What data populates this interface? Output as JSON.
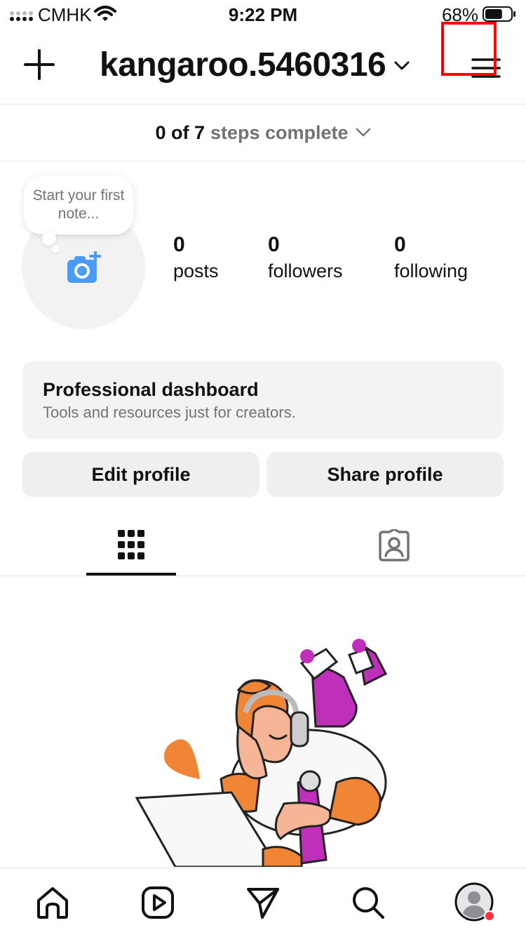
{
  "status_bar": {
    "carrier": "CMHK",
    "time": "9:22 PM",
    "battery_percent": "68%",
    "battery_level": 0.68,
    "icons": [
      "signal-icon",
      "wifi-icon",
      "battery-icon"
    ]
  },
  "header": {
    "username": "kangaroo.5460316",
    "icons": [
      "plus-icon",
      "chevron-down-icon",
      "menu-icon"
    ],
    "highlight_color": "#ff0000"
  },
  "steps": {
    "prefix": "0 of 7",
    "suffix": "steps complete"
  },
  "profile": {
    "note_placeholder": "Start your first note...",
    "camera_icon": "add-photo-icon",
    "accent": "#4a9bf5",
    "stats": [
      {
        "value": "0",
        "label": "posts"
      },
      {
        "value": "0",
        "label": "followers"
      },
      {
        "value": "0",
        "label": "following"
      }
    ]
  },
  "dashboard": {
    "title": "Professional dashboard",
    "subtitle": "Tools and resources just for creators."
  },
  "actions": {
    "edit": "Edit profile",
    "share": "Share profile"
  },
  "tabs": [
    {
      "icon": "grid-icon",
      "active": true
    },
    {
      "icon": "tagged-icon",
      "active": false
    }
  ],
  "bottom_nav": [
    {
      "icon": "home-icon"
    },
    {
      "icon": "reels-icon"
    },
    {
      "icon": "messages-icon"
    },
    {
      "icon": "search-icon"
    },
    {
      "icon": "profile-avatar-icon",
      "badge_color": "#ff3040"
    }
  ]
}
